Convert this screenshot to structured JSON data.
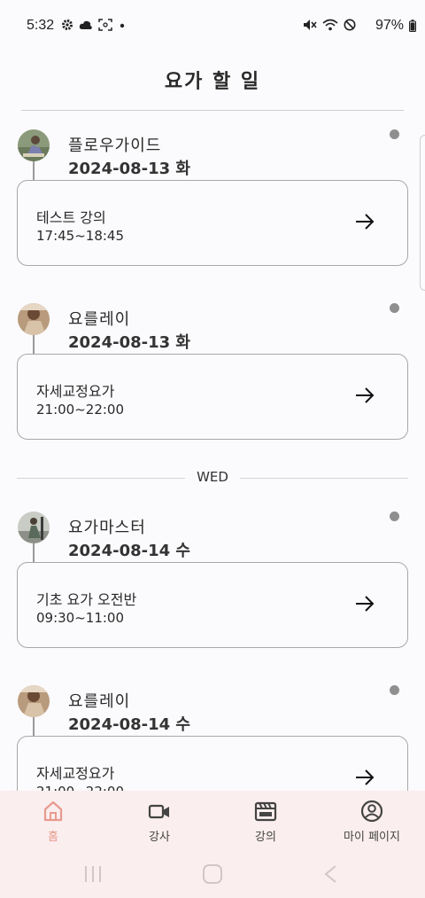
{
  "status_bar": {
    "time": "5:32",
    "battery": "97%",
    "icons": [
      "gear-icon",
      "cloud-icon",
      "screenshot-icon",
      "dot-icon",
      "mute-icon",
      "wifi-icon",
      "do-not-disturb-icon",
      "battery-icon"
    ]
  },
  "page": {
    "title": "요가 할 일"
  },
  "schedule": [
    {
      "instructor": "플로우가이드",
      "date": "2024-08-13 화",
      "lecture": "테스트 강의",
      "time": "17:45~18:45"
    },
    {
      "instructor": "요를레이",
      "date": "2024-08-13 화",
      "lecture": "자세교정요가",
      "time": "21:00~22:00"
    },
    {
      "instructor": "요가마스터",
      "date": "2024-08-14 수",
      "lecture": "기초 요가 오전반",
      "time": "09:30~11:00"
    },
    {
      "instructor": "요를레이",
      "date": "2024-08-14 수",
      "lecture": "자세교정요가",
      "time": "21:00~22:00"
    }
  ],
  "day_separator": "WED",
  "bottom_nav": [
    {
      "label": "홈",
      "icon": "home-icon",
      "active": true
    },
    {
      "label": "강사",
      "icon": "video-camera-icon",
      "active": false
    },
    {
      "label": "강의",
      "icon": "clapperboard-icon",
      "active": false
    },
    {
      "label": "마이 페이지",
      "icon": "user-circle-icon",
      "active": false
    }
  ],
  "colors": {
    "accent": "#e89a8e",
    "nav_background": "#fbeeee",
    "card_border": "#a8a8a8"
  }
}
